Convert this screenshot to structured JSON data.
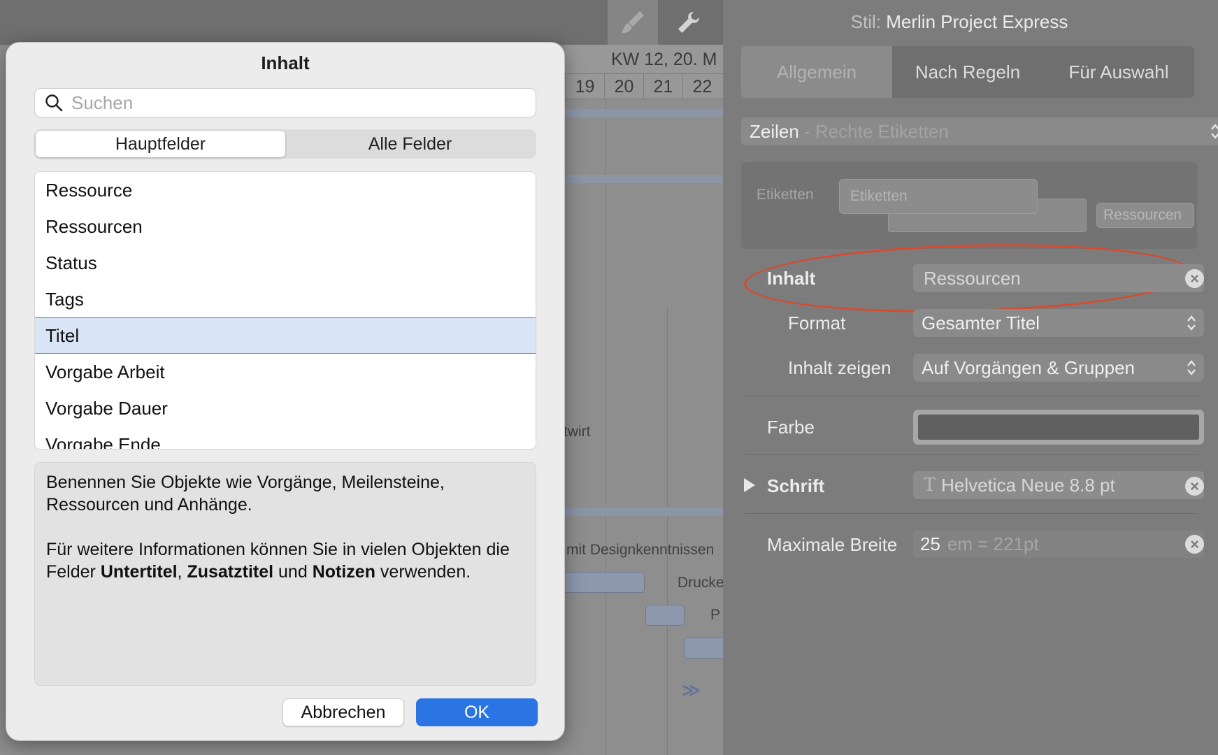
{
  "toolbar": {
    "brush_icon": "paintbrush-icon",
    "wrench_icon": "wrench-icon"
  },
  "gantt": {
    "week": "KW 12, 20. M",
    "days": [
      "19",
      "20",
      "21",
      "22"
    ],
    "texts": [
      "twirt",
      "mit Designkenntnissen",
      "Drucke",
      "P"
    ],
    "more_glyph": "≫"
  },
  "inspector": {
    "style_prefix": "Stil:",
    "style_name": "Merlin Project Express",
    "tabs": [
      "Allgemein",
      "Nach Regeln",
      "Für Auswahl"
    ],
    "rows_popup": {
      "main": "Zeilen",
      "separator": " - ",
      "sub": "Rechte Etiketten"
    },
    "labels_title": "Etiketten",
    "labels_field": "Etiketten",
    "labels_chip": "Ressourcen",
    "content_label": "Inhalt",
    "content_value": "Ressourcen",
    "format_label": "Format",
    "format_value": "Gesamter Titel",
    "show_label": "Inhalt zeigen",
    "show_value": "Auf Vorgängen & Gruppen",
    "color_label": "Farbe",
    "color_value": "#606060",
    "font_label": "Schrift",
    "font_value": "Helvetica Neue 8.8 pt",
    "maxwidth_label": "Maximale Breite",
    "maxwidth_value": "25",
    "maxwidth_unit": "em = 221pt"
  },
  "dialog": {
    "title": "Inhalt",
    "search_placeholder": "Suchen",
    "tabs": [
      "Hauptfelder",
      "Alle Felder"
    ],
    "selected_tab": "Hauptfelder",
    "fields": [
      "Ressource",
      "Ressourcen",
      "Status",
      "Tags",
      "Titel",
      "Vorgabe Arbeit",
      "Vorgabe Dauer",
      "Vorgabe Ende"
    ],
    "selected_field": "Titel",
    "description_1": "Benennen Sie Objekte wie Vorgänge, Meilensteine, Ressourcen und Anhänge.",
    "description_2_start": "Für weitere Informationen können Sie in vielen Objekten die Felder ",
    "description_2_b1": "Untertitel",
    "description_2_comma": ", ",
    "description_2_b2": "Zusatztitel",
    "description_2_and": " und ",
    "description_2_b3": "Notizen",
    "description_2_end": " verwenden.",
    "cancel_label": "Abbrechen",
    "ok_label": "OK"
  },
  "colors": {
    "accent": "#2b74e4",
    "highlight_oval": "#d84a2e",
    "selection": "#d9e5f7"
  }
}
